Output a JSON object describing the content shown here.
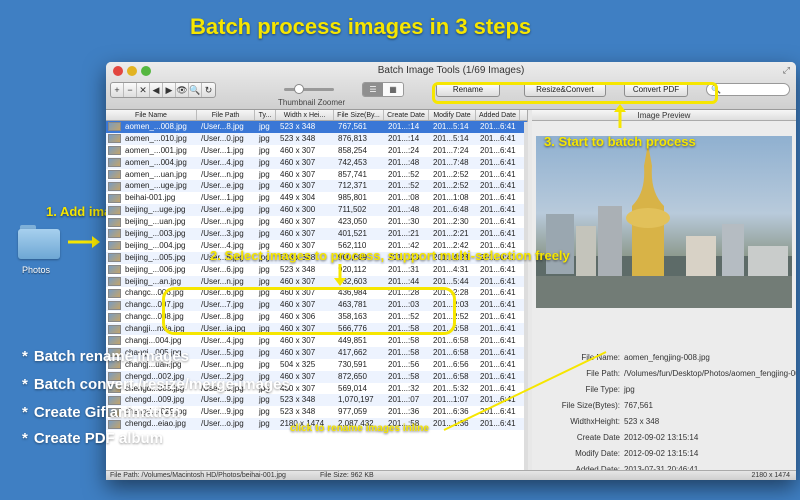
{
  "promo": {
    "title": "Batch process images in 3 steps",
    "step1": "1. Add images to app",
    "step2": "2. Select images to process, support multi-selection freely",
    "step3": "3. Start to batch process",
    "inline_hint": "click to rename images inline",
    "features": [
      "Batch rename images",
      "Batch convert /resize/merge images",
      "Create Gif animation",
      "Create PDF album"
    ],
    "star": "*",
    "accent_color": "#f6e600"
  },
  "desktop": {
    "folder_label": "Photos",
    "folder_icon": "folder-icon"
  },
  "window": {
    "title": "Batch Image Tools (1/69 Images)",
    "toolbar": [
      "+",
      "−",
      "✕",
      "◀",
      "▶",
      "👁",
      "🔍",
      "↻"
    ],
    "zoom_label": "Thumbnail Zoomer",
    "zoom_level": 0.3,
    "view_list": "☰",
    "view_grid": "▦",
    "rename_label": "Rename",
    "resize_label": "Resize&Convert",
    "pdf_label": "Convert PDF",
    "search_placeholder": "🔍"
  },
  "table": {
    "headers": [
      "File Name",
      "File Path",
      "Ty...",
      "Width x Hei...",
      "File Size(By...",
      "Create Date",
      "Modify Date",
      "Added Date"
    ],
    "rows": [
      [
        "aomen_...008.jpg",
        "/User...8.jpg",
        "jpg",
        "523 x 348",
        "767,561",
        "201...:14",
        "201...5:14",
        "201...6:41"
      ],
      [
        "aomen_...010.jpg",
        "/User...0.jpg",
        "jpg",
        "523 x 348",
        "876,813",
        "201...:14",
        "201...5:14",
        "201...6:41"
      ],
      [
        "aomen_...001.jpg",
        "/User...1.jpg",
        "jpg",
        "460 x 307",
        "858,254",
        "201...:24",
        "201...7:24",
        "201...6:41"
      ],
      [
        "aomen_...004.jpg",
        "/User...4.jpg",
        "jpg",
        "460 x 307",
        "742,453",
        "201...:48",
        "201...7:48",
        "201...6:41"
      ],
      [
        "aomen_...uan.jpg",
        "/User...n.jpg",
        "jpg",
        "460 x 307",
        "857,741",
        "201...:52",
        "201...2:52",
        "201...6:41"
      ],
      [
        "aomen_...uge.jpg",
        "/User...e.jpg",
        "jpg",
        "460 x 307",
        "712,371",
        "201...:52",
        "201...2:52",
        "201...6:41"
      ],
      [
        "beihai-001.jpg",
        "/User...1.jpg",
        "jpg",
        "449 x 304",
        "985,801",
        "201...:08",
        "201...1:08",
        "201...6:41"
      ],
      [
        "beijing_...uge.jpg",
        "/User...e.jpg",
        "jpg",
        "460 x 300",
        "711,502",
        "201...:48",
        "201...6:48",
        "201...6:41"
      ],
      [
        "beijing_...uan.jpg",
        "/User...n.jpg",
        "jpg",
        "460 x 307",
        "423,050",
        "201...:30",
        "201...2:30",
        "201...6:41"
      ],
      [
        "beijing_...003.jpg",
        "/User...3.jpg",
        "jpg",
        "460 x 307",
        "401,521",
        "201...:21",
        "201...2:21",
        "201...6:41"
      ],
      [
        "beijing_...004.jpg",
        "/User...4.jpg",
        "jpg",
        "460 x 307",
        "562,110",
        "201...:42",
        "201...2:42",
        "201...6:41"
      ],
      [
        "beijing_...005.jpg",
        "/User...5.jpg",
        "jpg",
        "523 x 348",
        "960,689",
        "201...:23",
        "201...4:23",
        "201...6:41"
      ],
      [
        "beijing_...006.jpg",
        "/User...6.jpg",
        "jpg",
        "523 x 348",
        "920,112",
        "201...:31",
        "201...4:31",
        "201...6:41"
      ],
      [
        "beijing_...an.jpg",
        "/User...n.jpg",
        "jpg",
        "460 x 307",
        "432,603",
        "201...:44",
        "201...5:44",
        "201...6:41"
      ],
      [
        "changc...006.jpg",
        "/User...6.jpg",
        "jpg",
        "460 x 307",
        "436,984",
        "201...:28",
        "201...2:28",
        "201...6:41"
      ],
      [
        "changc...007.jpg",
        "/User...7.jpg",
        "jpg",
        "460 x 307",
        "463,781",
        "201...:03",
        "201...2:03",
        "201...6:41"
      ],
      [
        "changc...008.jpg",
        "/User...8.jpg",
        "jpg",
        "460 x 306",
        "358,163",
        "201...:52",
        "201...2:52",
        "201...6:41"
      ],
      [
        "changji...nxia.jpg",
        "/User...ia.jpg",
        "jpg",
        "460 x 307",
        "566,776",
        "201...:58",
        "201...6:58",
        "201...6:41"
      ],
      [
        "changj...004.jpg",
        "/User...4.jpg",
        "jpg",
        "460 x 307",
        "449,851",
        "201...:58",
        "201...6:58",
        "201...6:41"
      ],
      [
        "changj...005.jpg",
        "/User...5.jpg",
        "jpg",
        "460 x 307",
        "417,662",
        "201...:58",
        "201...6:58",
        "201...6:41"
      ],
      [
        "changj...uan.jpg",
        "/User...n.jpg",
        "jpg",
        "504 x 325",
        "730,591",
        "201...:56",
        "201...6:56",
        "201...6:41"
      ],
      [
        "chengd...002.jpg",
        "/User...2.jpg",
        "jpg",
        "460 x 307",
        "872,650",
        "201...:58",
        "201...6:58",
        "201...6:41"
      ],
      [
        "chengd...005.jpg",
        "/User...5.jpg",
        "jpg",
        "460 x 307",
        "569,014",
        "201...:32",
        "201...5:32",
        "201...6:41"
      ],
      [
        "chengd...009.jpg",
        "/User...9.jpg",
        "jpg",
        "523 x 348",
        "1,070,197",
        "201...:07",
        "201...1:07",
        "201...6:41"
      ],
      [
        "chengd...-029.jpg",
        "/User...9.jpg",
        "jpg",
        "523 x 348",
        "977,059",
        "201...:36",
        "201...6:36",
        "201...6:41"
      ],
      [
        "chengd...eiao.jpg",
        "/User...o.jpg",
        "jpg",
        "2180 x 1474",
        "2,087,432",
        "201...:58",
        "201...1:36",
        "201...6:41"
      ]
    ]
  },
  "preview": {
    "title": "Image Preview",
    "fields": [
      {
        "k": "File Name:",
        "v": "aomen_fengjing-008.jpg"
      },
      {
        "k": "File Path:",
        "v": "/Volumes/fun/Desktop/Photos/aomen_fengjing-008.jpg"
      },
      {
        "k": "File Type:",
        "v": "jpg"
      },
      {
        "k": "File Size(Bytes):",
        "v": "767,561"
      },
      {
        "k": "WidthxHeight:",
        "v": "523 x 348"
      },
      {
        "k": "Create Date",
        "v": "2012-09-02   13:15:14"
      },
      {
        "k": "Modify Date:",
        "v": "2012-09-02   13:15:14"
      },
      {
        "k": "Added Date:",
        "v": "2013-07-31   20:46:41"
      }
    ]
  },
  "status": {
    "path": "File Path: /Volumes/Macintosh HD/Photos/beihai-001.jpg",
    "size": "File Size: 962 KB",
    "dims": "2180 x 1474"
  }
}
